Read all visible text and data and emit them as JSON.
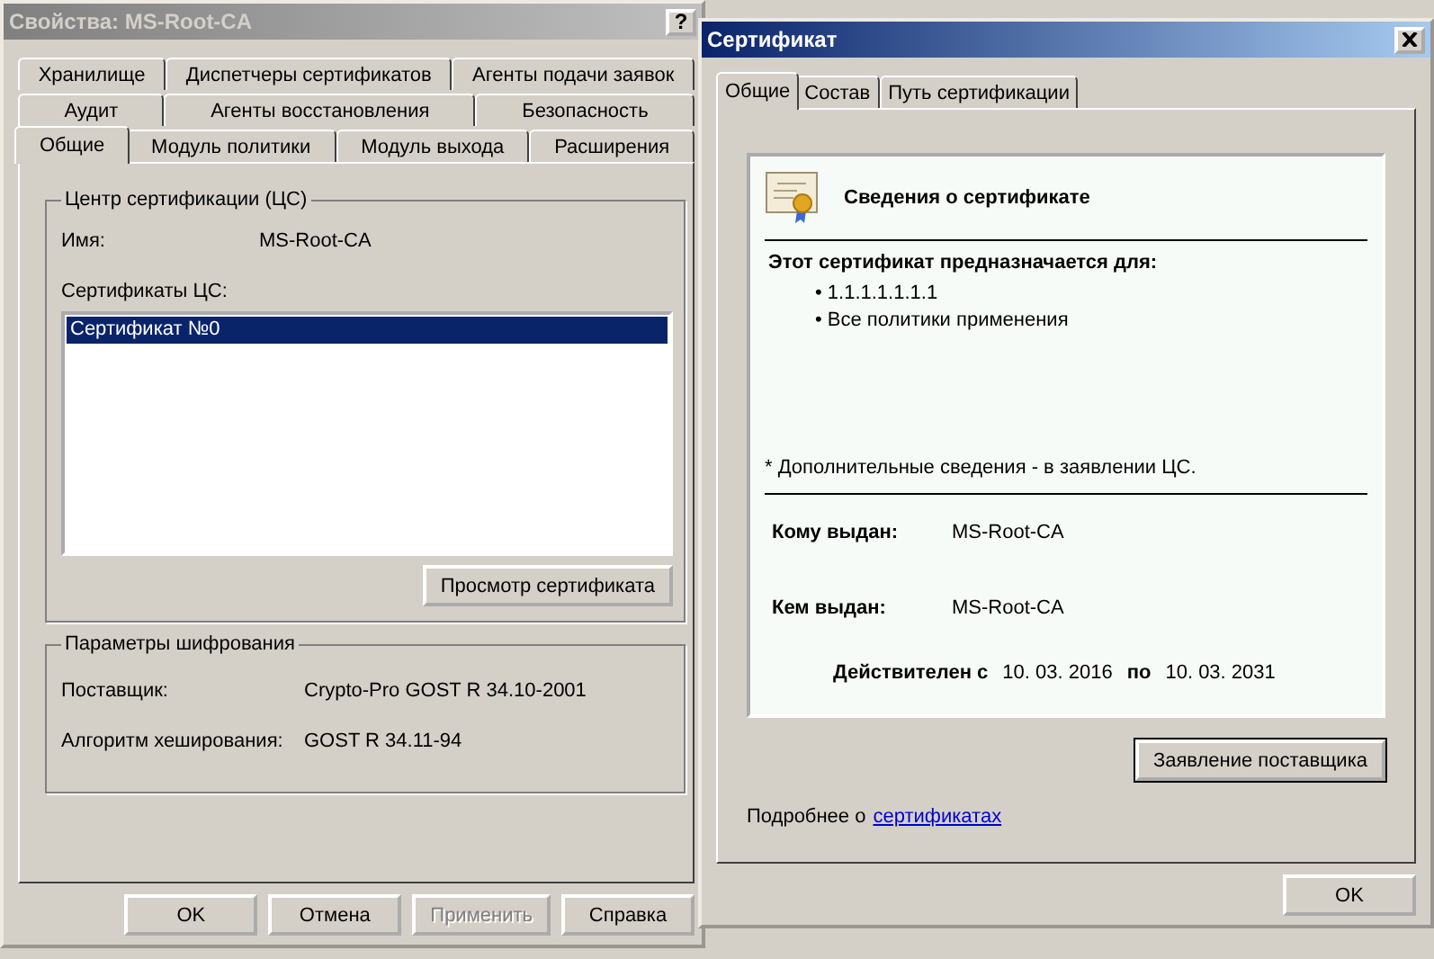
{
  "properties_window": {
    "title": "Свойства: MS-Root-CA",
    "active": false,
    "help_glyph": "?",
    "tab_rows": [
      [
        {
          "label": "Хранилище",
          "selected": false
        },
        {
          "label": "Диспетчеры сертификатов",
          "selected": false
        },
        {
          "label": "Агенты подачи заявок",
          "selected": false
        }
      ],
      [
        {
          "label": "Аудит",
          "selected": false
        },
        {
          "label": "Агенты восстановления",
          "selected": false
        },
        {
          "label": "Безопасность",
          "selected": false
        }
      ],
      [
        {
          "label": "Общие",
          "selected": true
        },
        {
          "label": "Модуль политики",
          "selected": false
        },
        {
          "label": "Модуль выхода",
          "selected": false
        },
        {
          "label": "Расширения",
          "selected": false
        }
      ]
    ],
    "ca_group": {
      "title": "Центр сертификации (ЦС)",
      "name_label": "Имя:",
      "name_value": "MS-Root-CA",
      "certs_label": "Сертификаты ЦС:",
      "certs": [
        {
          "label": "Сертификат №0",
          "selected": true
        }
      ],
      "view_button": "Просмотр сертификата"
    },
    "crypto_group": {
      "title": "Параметры шифрования",
      "rows": [
        {
          "label": "Поставщик:",
          "value": "Crypto-Pro GOST R 34.10-2001"
        },
        {
          "label": "Алгоритм хеширования:",
          "value": "GOST R 34.11-94"
        }
      ]
    },
    "buttons": [
      {
        "label": "OK",
        "disabled": false
      },
      {
        "label": "Отмена",
        "disabled": false
      },
      {
        "label": "Применить",
        "disabled": true
      },
      {
        "label": "Справка",
        "disabled": false
      }
    ]
  },
  "certificate_window": {
    "title": "Сертификат",
    "active": true,
    "tabs": [
      {
        "label": "Общие",
        "selected": true
      },
      {
        "label": "Состав",
        "selected": false
      },
      {
        "label": "Путь сертификации",
        "selected": false
      }
    ],
    "info_title": "Сведения о сертификате",
    "purpose_title": "Этот сертификат предназначается для:",
    "purposes": [
      "• 1.1.1.1.1.1.1",
      "• Все политики применения"
    ],
    "note": "* Дополнительные сведения - в заявлении ЦС.",
    "issued_to_label": "Кому выдан:",
    "issued_to": "MS-Root-CA",
    "issued_by_label": "Кем выдан:",
    "issued_by": "MS-Root-CA",
    "valid_from_label": "Действителен с",
    "valid_from": "10. 03. 2016",
    "valid_to_label": "по",
    "valid_to": "10. 03. 2031",
    "statement_button": "Заявление поставщика",
    "more_text": "Подробнее о",
    "more_link": "сертификатах",
    "ok_button": "OK"
  }
}
